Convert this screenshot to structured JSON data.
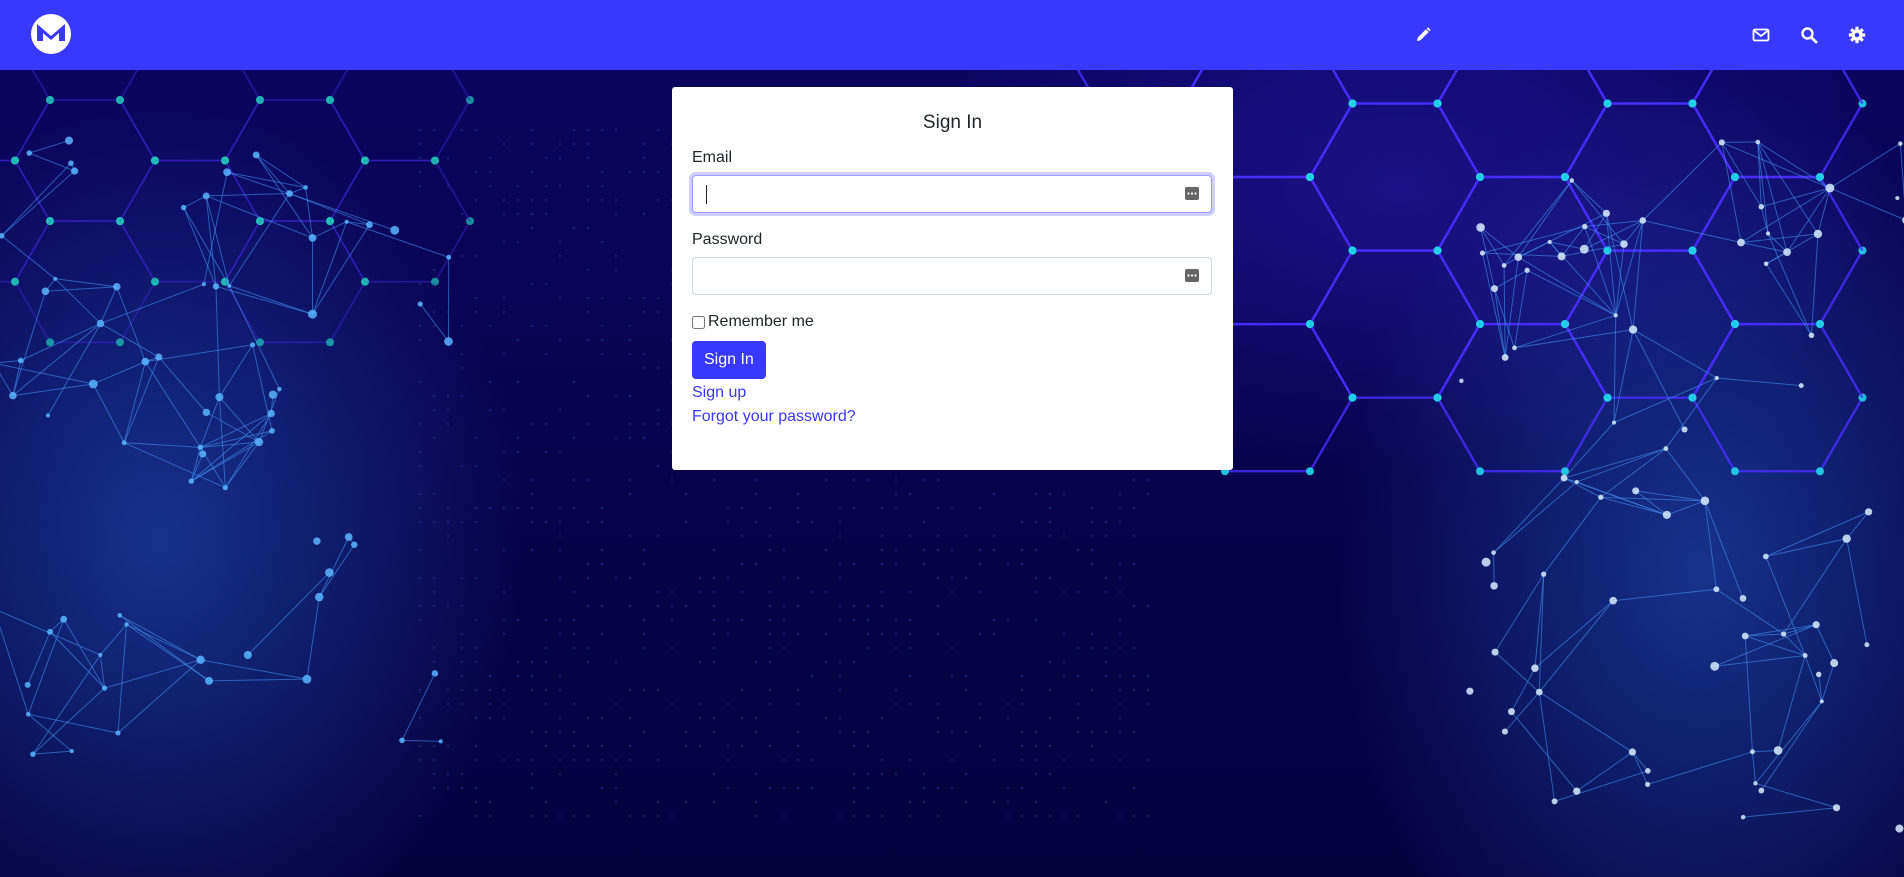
{
  "navbar": {
    "logo_icon": "monero-logo-icon",
    "bg_color": "#3838ff",
    "icons": [
      {
        "name": "pencil-icon"
      },
      {
        "name": "envelope-icon"
      },
      {
        "name": "search-icon"
      },
      {
        "name": "gear-icon"
      }
    ]
  },
  "signin": {
    "title": "Sign In",
    "email_label": "Email",
    "email_value": "",
    "password_label": "Password",
    "password_value": "",
    "remember_label": "Remember me",
    "remember_checked": false,
    "submit_label": "Sign In",
    "signup_link": "Sign up",
    "forgot_link": "Forgot your password?"
  },
  "colors": {
    "accent": "#3838ff",
    "background": "#08024a",
    "card": "#ffffff",
    "text": "#212529"
  }
}
